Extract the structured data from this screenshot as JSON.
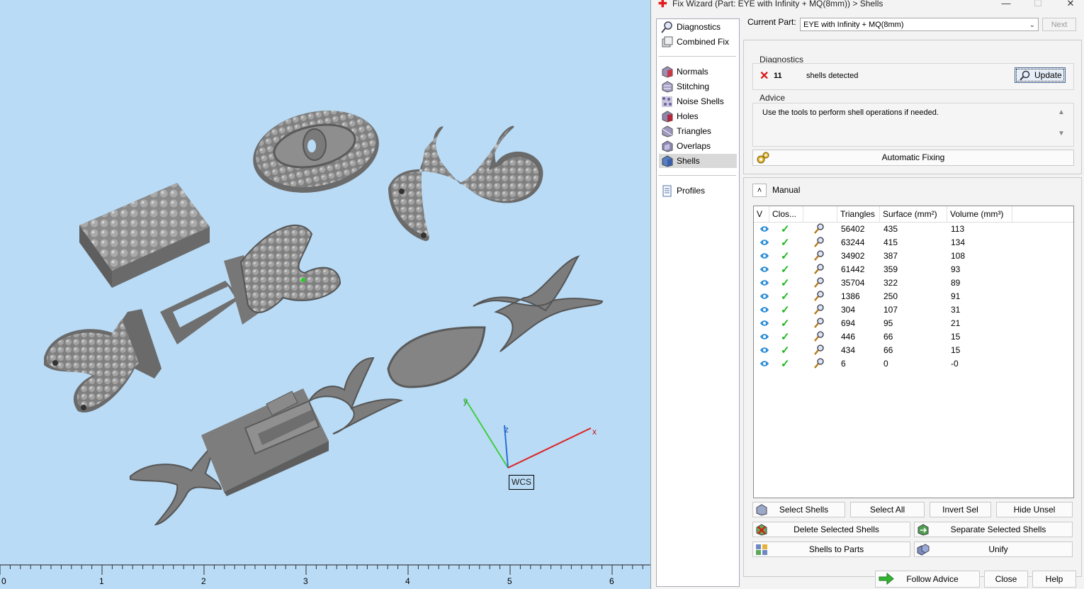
{
  "viewport": {
    "ruler_ticks": [
      "0",
      "1",
      "2",
      "3",
      "4",
      "5",
      "6"
    ],
    "axes": {
      "x": "x",
      "y": "y",
      "z": "z"
    },
    "wcs_label": "WCS"
  },
  "dialog": {
    "title": "Fix Wizard (Part: EYE with Infinity + MQ(8mm)) > Shells",
    "window_controls": {
      "minimize": "—",
      "maximize": "☐",
      "close": "✕"
    },
    "nav": [
      {
        "label": "Diagnostics",
        "icon": "diagnostics-icon"
      },
      {
        "label": "Combined Fix",
        "icon": "combined-fix-icon"
      },
      {
        "label": "Normals",
        "icon": "normals-icon"
      },
      {
        "label": "Stitching",
        "icon": "stitching-icon"
      },
      {
        "label": "Noise Shells",
        "icon": "noise-shells-icon"
      },
      {
        "label": "Holes",
        "icon": "holes-icon"
      },
      {
        "label": "Triangles",
        "icon": "triangles-icon"
      },
      {
        "label": "Overlaps",
        "icon": "overlaps-icon"
      },
      {
        "label": "Shells",
        "icon": "shells-icon",
        "active": true
      },
      {
        "label": "Profiles",
        "icon": "profiles-icon"
      }
    ],
    "current_part_label": "Current Part:",
    "current_part_value": "EYE with Infinity + MQ(8mm)",
    "next_label": "Next",
    "diagnostics": {
      "title": "Diagnostics",
      "count": "11",
      "message": "shells detected",
      "update_label": "Update"
    },
    "advice": {
      "title": "Advice",
      "text": "Use the tools to perform shell operations if needed."
    },
    "automatic_fixing_label": "Automatic Fixing",
    "manual_label": "Manual",
    "table": {
      "columns": [
        "V",
        "Clos...",
        "",
        "Triangles",
        "Surface (mm²)",
        "Volume (mm³)"
      ],
      "rows": [
        {
          "triangles": "56402",
          "surface": "435",
          "volume": "113"
        },
        {
          "triangles": "63244",
          "surface": "415",
          "volume": "134"
        },
        {
          "triangles": "34902",
          "surface": "387",
          "volume": "108"
        },
        {
          "triangles": "61442",
          "surface": "359",
          "volume": "93"
        },
        {
          "triangles": "35704",
          "surface": "322",
          "volume": "89"
        },
        {
          "triangles": "1386",
          "surface": "250",
          "volume": "91"
        },
        {
          "triangles": "304",
          "surface": "107",
          "volume": "31"
        },
        {
          "triangles": "694",
          "surface": "95",
          "volume": "21"
        },
        {
          "triangles": "446",
          "surface": "66",
          "volume": "15"
        },
        {
          "triangles": "434",
          "surface": "66",
          "volume": "15"
        },
        {
          "triangles": "6",
          "surface": "0",
          "volume": "-0"
        }
      ]
    },
    "buttons": {
      "select_shells": "Select Shells",
      "select_all": "Select All",
      "invert_sel": "Invert Sel",
      "hide_unsel": "Hide Unsel",
      "delete_selected": "Delete Selected Shells",
      "separate_selected": "Separate Selected Shells",
      "shells_to_parts": "Shells to Parts",
      "unify": "Unify",
      "follow_advice": "Follow Advice",
      "close": "Close",
      "help": "Help"
    },
    "colors": {
      "check": "#1fb51f",
      "error_x": "#d11111",
      "eye": "#2d8ed6",
      "viewport_bg": "#b9dbf5"
    }
  }
}
